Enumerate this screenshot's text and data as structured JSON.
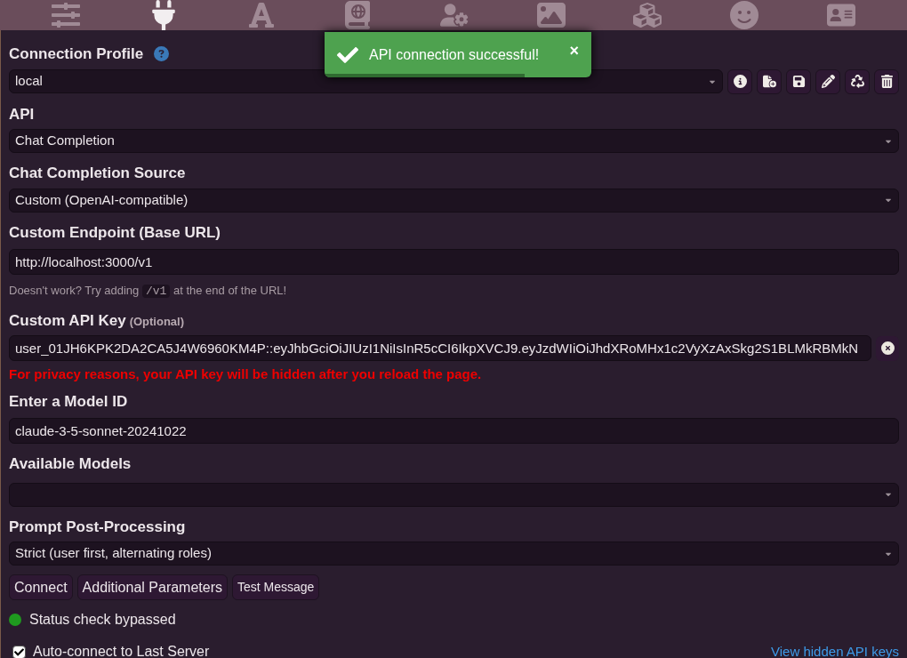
{
  "nav_tabs": [
    {
      "kind": "sliders",
      "selected": false
    },
    {
      "kind": "plug",
      "selected": true
    },
    {
      "kind": "font",
      "selected": false
    },
    {
      "kind": "book",
      "selected": false
    },
    {
      "kind": "user-gear",
      "selected": false
    },
    {
      "kind": "image",
      "selected": false
    },
    {
      "kind": "cubes",
      "selected": false
    },
    {
      "kind": "smiley",
      "selected": false
    },
    {
      "kind": "id-card",
      "selected": false
    }
  ],
  "toast": {
    "message": "API connection successful!",
    "close": "×",
    "level": 0.75
  },
  "connection_profile": {
    "label": "Connection Profile",
    "value": "local"
  },
  "api": {
    "label": "API",
    "value": "Chat Completion"
  },
  "source": {
    "label": "Chat Completion Source",
    "value": "Custom (OpenAI-compatible)"
  },
  "endpoint": {
    "label": "Custom Endpoint (Base URL)",
    "value": "http://localhost:3000/v1",
    "hint_before": "Doesn't work? Try adding",
    "hint_code": "/v1",
    "hint_after": "at the end of the URL!"
  },
  "api_key": {
    "label": "Custom API Key",
    "label_note": "(Optional)",
    "value": "user_01JH6KPK2DA2CA5J4W6960KM4P::eyJhbGciOiJIUzI1NiIsInR5cCI6IkpXVCJ9.eyJzdWIiOiJhdXRoMHx1c2VyXzAxSkg2S1BLMkRBMkN",
    "warning": "For privacy reasons, your API key will be hidden after you reload the page."
  },
  "model_id": {
    "label": "Enter a Model ID",
    "value": "claude-3-5-sonnet-20241022"
  },
  "available_models": {
    "label": "Available Models"
  },
  "post_processing": {
    "label": "Prompt Post-Processing",
    "value": "Strict (user first, alternating roles)"
  },
  "buttons": [
    {
      "label": "Connect",
      "kind": "normal"
    },
    {
      "label": "Additional Parameters",
      "kind": "normal"
    },
    {
      "label": "Test Message",
      "kind": "small"
    }
  ],
  "status": {
    "text": "Status check bypassed",
    "color": "#1f9a1f"
  },
  "auto_connect": {
    "label": "Auto-connect to Last Server",
    "checked": true
  },
  "hidden_keys_link": "View hidden API keys"
}
